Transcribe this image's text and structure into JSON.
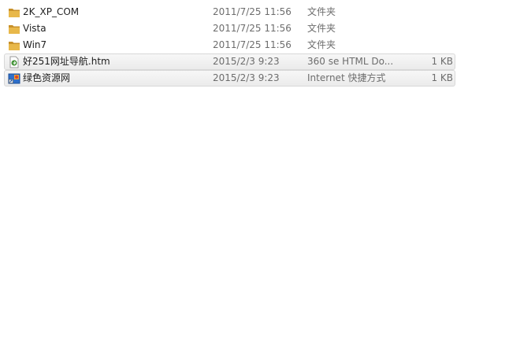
{
  "files": [
    {
      "name": "2K_XP_COM",
      "date": "2011/7/25 11:56",
      "type": "文件夹",
      "size": "",
      "icon": "folder-icon"
    },
    {
      "name": "Vista",
      "date": "2011/7/25 11:56",
      "type": "文件夹",
      "size": "",
      "icon": "folder-icon"
    },
    {
      "name": "Win7",
      "date": "2011/7/25 11:56",
      "type": "文件夹",
      "size": "",
      "icon": "folder-icon"
    },
    {
      "name": "好251网址导航.htm",
      "date": "2015/2/3 9:23",
      "type": "360 se HTML Do...",
      "size": "1 KB",
      "icon": "html-file-icon"
    },
    {
      "name": "绿色资源网",
      "date": "2015/2/3 9:23",
      "type": "Internet 快捷方式",
      "size": "1 KB",
      "icon": "internet-shortcut-icon"
    }
  ],
  "colors": {
    "folder": "#e8b84a",
    "folder_dark": "#c8912a",
    "html_icon": "#3b8f2f",
    "shortcut_icon": "#2f6fc9"
  }
}
